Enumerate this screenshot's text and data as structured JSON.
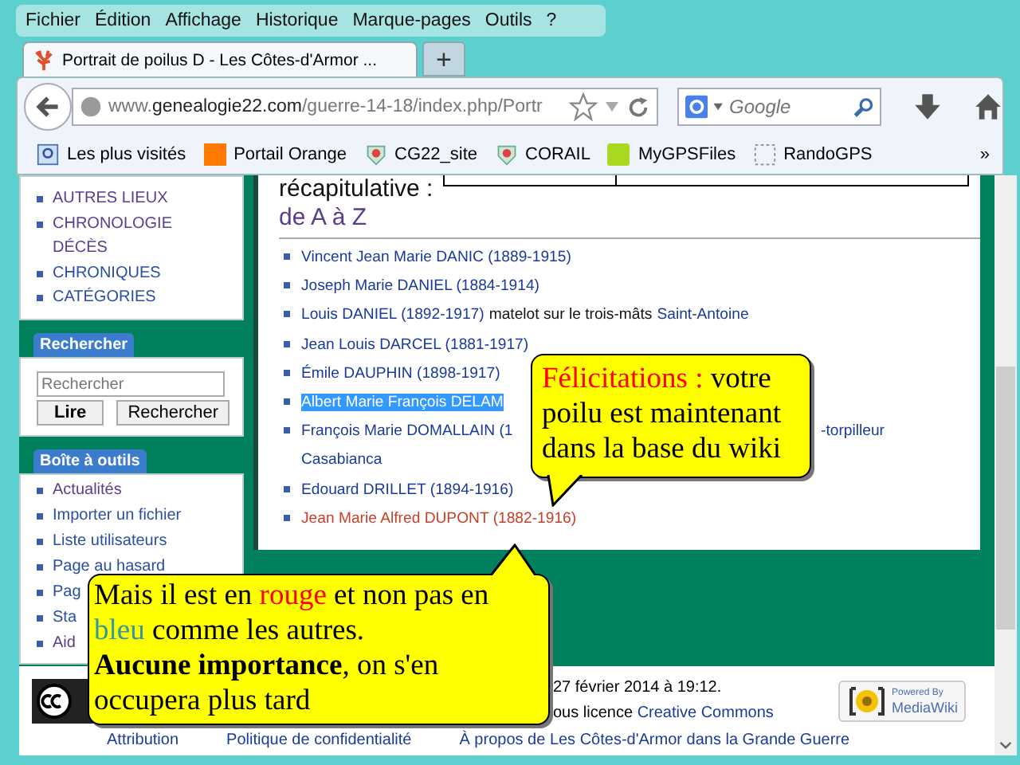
{
  "menu": [
    "Fichier",
    "Édition",
    "Affichage",
    "Historique",
    "Marque-pages",
    "Outils",
    "?"
  ],
  "tabs": [
    {
      "label": "Portrait de poilus D - Les Côtes-d'Armor ...",
      "selected": true
    }
  ],
  "new_tab": "+",
  "url": {
    "domain_prefix": "www.",
    "domain": "genealogie22.com",
    "path": "/guerre-14-18/index.php/Portr"
  },
  "search": {
    "placeholder": "Google"
  },
  "bookmarks": [
    "Les plus visités",
    "Portail Orange",
    "CG22_site",
    "CORAIL",
    "MyGPSFiles",
    "RandoGPS"
  ],
  "bookmarks_more": "»",
  "sidebar": {
    "nav": [
      {
        "label": "AUTRES LIEUX",
        "visited": true
      },
      {
        "label": "CHRONOLOGIE DÉCÈS",
        "visited": true
      },
      {
        "label": "CHRONIQUES",
        "visited": false
      },
      {
        "label": "CATÉGORIES",
        "visited": false
      }
    ],
    "search_title": "Rechercher",
    "search_placeholder": "Rechercher",
    "search_buttons": [
      "Lire",
      "Rechercher"
    ],
    "tools_title": "Boîte à outils",
    "tools": [
      {
        "label": "Actualités",
        "visited": true
      },
      {
        "label": "Importer un fichier",
        "visited": false
      },
      {
        "label": "Liste utilisateurs",
        "visited": false
      },
      {
        "label": "Page au hasard",
        "visited": false
      },
      {
        "label": "Pag",
        "visited": false
      },
      {
        "label": "Sta",
        "visited": false
      },
      {
        "label": "Aid",
        "visited": true
      }
    ]
  },
  "main": {
    "heading": "récapitulative :",
    "heading_link": "de A à Z",
    "items": [
      {
        "selected": false,
        "segments": [
          {
            "text": "Vincent Jean Marie DANIC (1889-1915)",
            "kind": "link"
          }
        ]
      },
      {
        "selected": false,
        "segments": [
          {
            "text": "Joseph Marie DANIEL (1884-1914)",
            "kind": "link"
          }
        ]
      },
      {
        "selected": false,
        "segments": [
          {
            "text": "Louis DANIEL (1892-1917)",
            "kind": "link"
          },
          {
            "text": "matelot sur le trois-mâts",
            "kind": "plain"
          },
          {
            "text": "Saint-Antoine",
            "kind": "link"
          }
        ]
      },
      {
        "selected": false,
        "segments": [
          {
            "text": "Jean Louis DARCEL (1881-1917)",
            "kind": "link"
          }
        ]
      },
      {
        "selected": false,
        "segments": [
          {
            "text": "Émile DAUPHIN (1898-1917)",
            "kind": "link"
          }
        ]
      },
      {
        "selected": true,
        "segments": [
          {
            "text": "Albert Marie François DELAM",
            "kind": "link"
          }
        ]
      },
      {
        "selected": false,
        "segments": [
          {
            "text": "François Marie DOMALLAIN (1",
            "kind": "link"
          },
          {
            "text": "-torpilleur",
            "kind": "tail"
          },
          {
            "text": "Casabianca",
            "kind": "wrap"
          }
        ]
      },
      {
        "selected": false,
        "segments": [
          {
            "text": "Edouard DRILLET (1894-1916)",
            "kind": "link"
          }
        ]
      },
      {
        "selected": false,
        "segments": [
          {
            "text": "Jean Marie Alfred DUPONT (1882-1916)",
            "kind": "redlink"
          }
        ]
      }
    ]
  },
  "footer": {
    "modified": "27 février 2014 à 19:12.",
    "license_prefix": "ous licence",
    "license_link": "Creative Commons",
    "badge_top": "Powered By",
    "badge_bottom": "MediaWiki",
    "links": [
      "Attribution",
      "Politique de confidentialité",
      "À propos de Les Côtes-d'Armor dans la Grande Guerre"
    ]
  },
  "callouts": [
    {
      "lines": [
        [
          {
            "text": "Félicitations :",
            "color": "#ff0000"
          },
          {
            "text": " votre",
            "color": "#000000"
          }
        ],
        [
          {
            "text": "poilu est maintenant",
            "color": "#000000"
          }
        ],
        [
          {
            "text": "dans la base du wiki",
            "color": "#000000"
          }
        ]
      ]
    },
    {
      "lines": [
        [
          {
            "text": "Mais il est en ",
            "color": "#000000"
          },
          {
            "text": "rouge",
            "color": "#ff0000"
          },
          {
            "text": " et non pas en",
            "color": "#000000"
          }
        ],
        [
          {
            "text": "bleu",
            "color": "#339999"
          },
          {
            "text": " comme les autres.",
            "color": "#000000"
          }
        ],
        [
          {
            "text": "**Aucune importance**, on s'en",
            "color": "#000000"
          }
        ],
        [
          {
            "text": "occupera plus tard",
            "color": "#000000"
          }
        ]
      ]
    }
  ]
}
